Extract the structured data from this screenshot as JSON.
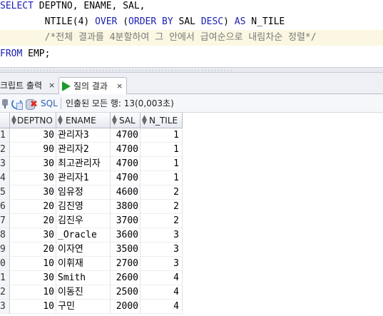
{
  "editor": {
    "line1": {
      "kw1": "SELECT",
      "rest": " DEPTNO, ENAME, SAL,"
    },
    "line2": {
      "indent": "        ",
      "fn": "NTILE",
      "arg": "(4) ",
      "kw_over": "OVER",
      "paren_open": " (",
      "kw_order": "ORDER BY",
      "mid": " SAL ",
      "kw_desc": "DESC",
      "paren_close": ") ",
      "kw_as": "AS",
      "alias": " N_TILE"
    },
    "line3": {
      "comment": "        /*전체 결과를 4분할하여 그 안에서 급여순으로 내림차순 정렬*/"
    },
    "line4": {
      "kw_from": "FROM",
      "rest": " EMP;"
    }
  },
  "tabs": {
    "script_output": "크립트 출력",
    "script_close": "×",
    "query_result": "질의 결과",
    "query_close": "×"
  },
  "toolbar": {
    "sql_label": "SQL",
    "status_text": "인출된 모든 행: 13(0,003초)"
  },
  "grid": {
    "columns": [
      "DEPTNO",
      "ENAME",
      "SAL",
      "N_TILE"
    ],
    "rows": [
      {
        "num": "1",
        "deptno": "30",
        "ename": "관리자3",
        "sal": "4700",
        "ntile": "1"
      },
      {
        "num": "2",
        "deptno": "90",
        "ename": "관리자2",
        "sal": "4700",
        "ntile": "1"
      },
      {
        "num": "3",
        "deptno": "30",
        "ename": "최고관리자",
        "sal": "4700",
        "ntile": "1"
      },
      {
        "num": "4",
        "deptno": "30",
        "ename": "관리자1",
        "sal": "4700",
        "ntile": "1"
      },
      {
        "num": "5",
        "deptno": "30",
        "ename": "임유정",
        "sal": "4600",
        "ntile": "2"
      },
      {
        "num": "6",
        "deptno": "20",
        "ename": "김진영",
        "sal": "3800",
        "ntile": "2"
      },
      {
        "num": "7",
        "deptno": "20",
        "ename": "김진우",
        "sal": "3700",
        "ntile": "2"
      },
      {
        "num": "8",
        "deptno": "30",
        "ename": "_Oracle",
        "sal": "3600",
        "ntile": "3"
      },
      {
        "num": "9",
        "deptno": "20",
        "ename": "이자연",
        "sal": "3500",
        "ntile": "3"
      },
      {
        "num": "0",
        "deptno": "10",
        "ename": "이휘재",
        "sal": "2700",
        "ntile": "3"
      },
      {
        "num": "1",
        "deptno": "30",
        "ename": "Smith",
        "sal": "2600",
        "ntile": "4"
      },
      {
        "num": "2",
        "deptno": "10",
        "ename": "이동진",
        "sal": "2500",
        "ntile": "4"
      },
      {
        "num": "3",
        "deptno": "10",
        "ename": "구민",
        "sal": "2000",
        "ntile": "4"
      }
    ]
  },
  "colors": {
    "keyword": "#1b20b0",
    "comment": "#7a7a7a",
    "run_icon": "#1c9b2a",
    "current_line": "#fbf7e2"
  },
  "icons": {
    "run_tab": "play-icon",
    "pin": "pin-icon",
    "refresh": "refresh-icon",
    "cancel": "cancel-query-icon",
    "sort": "sort-icon"
  }
}
